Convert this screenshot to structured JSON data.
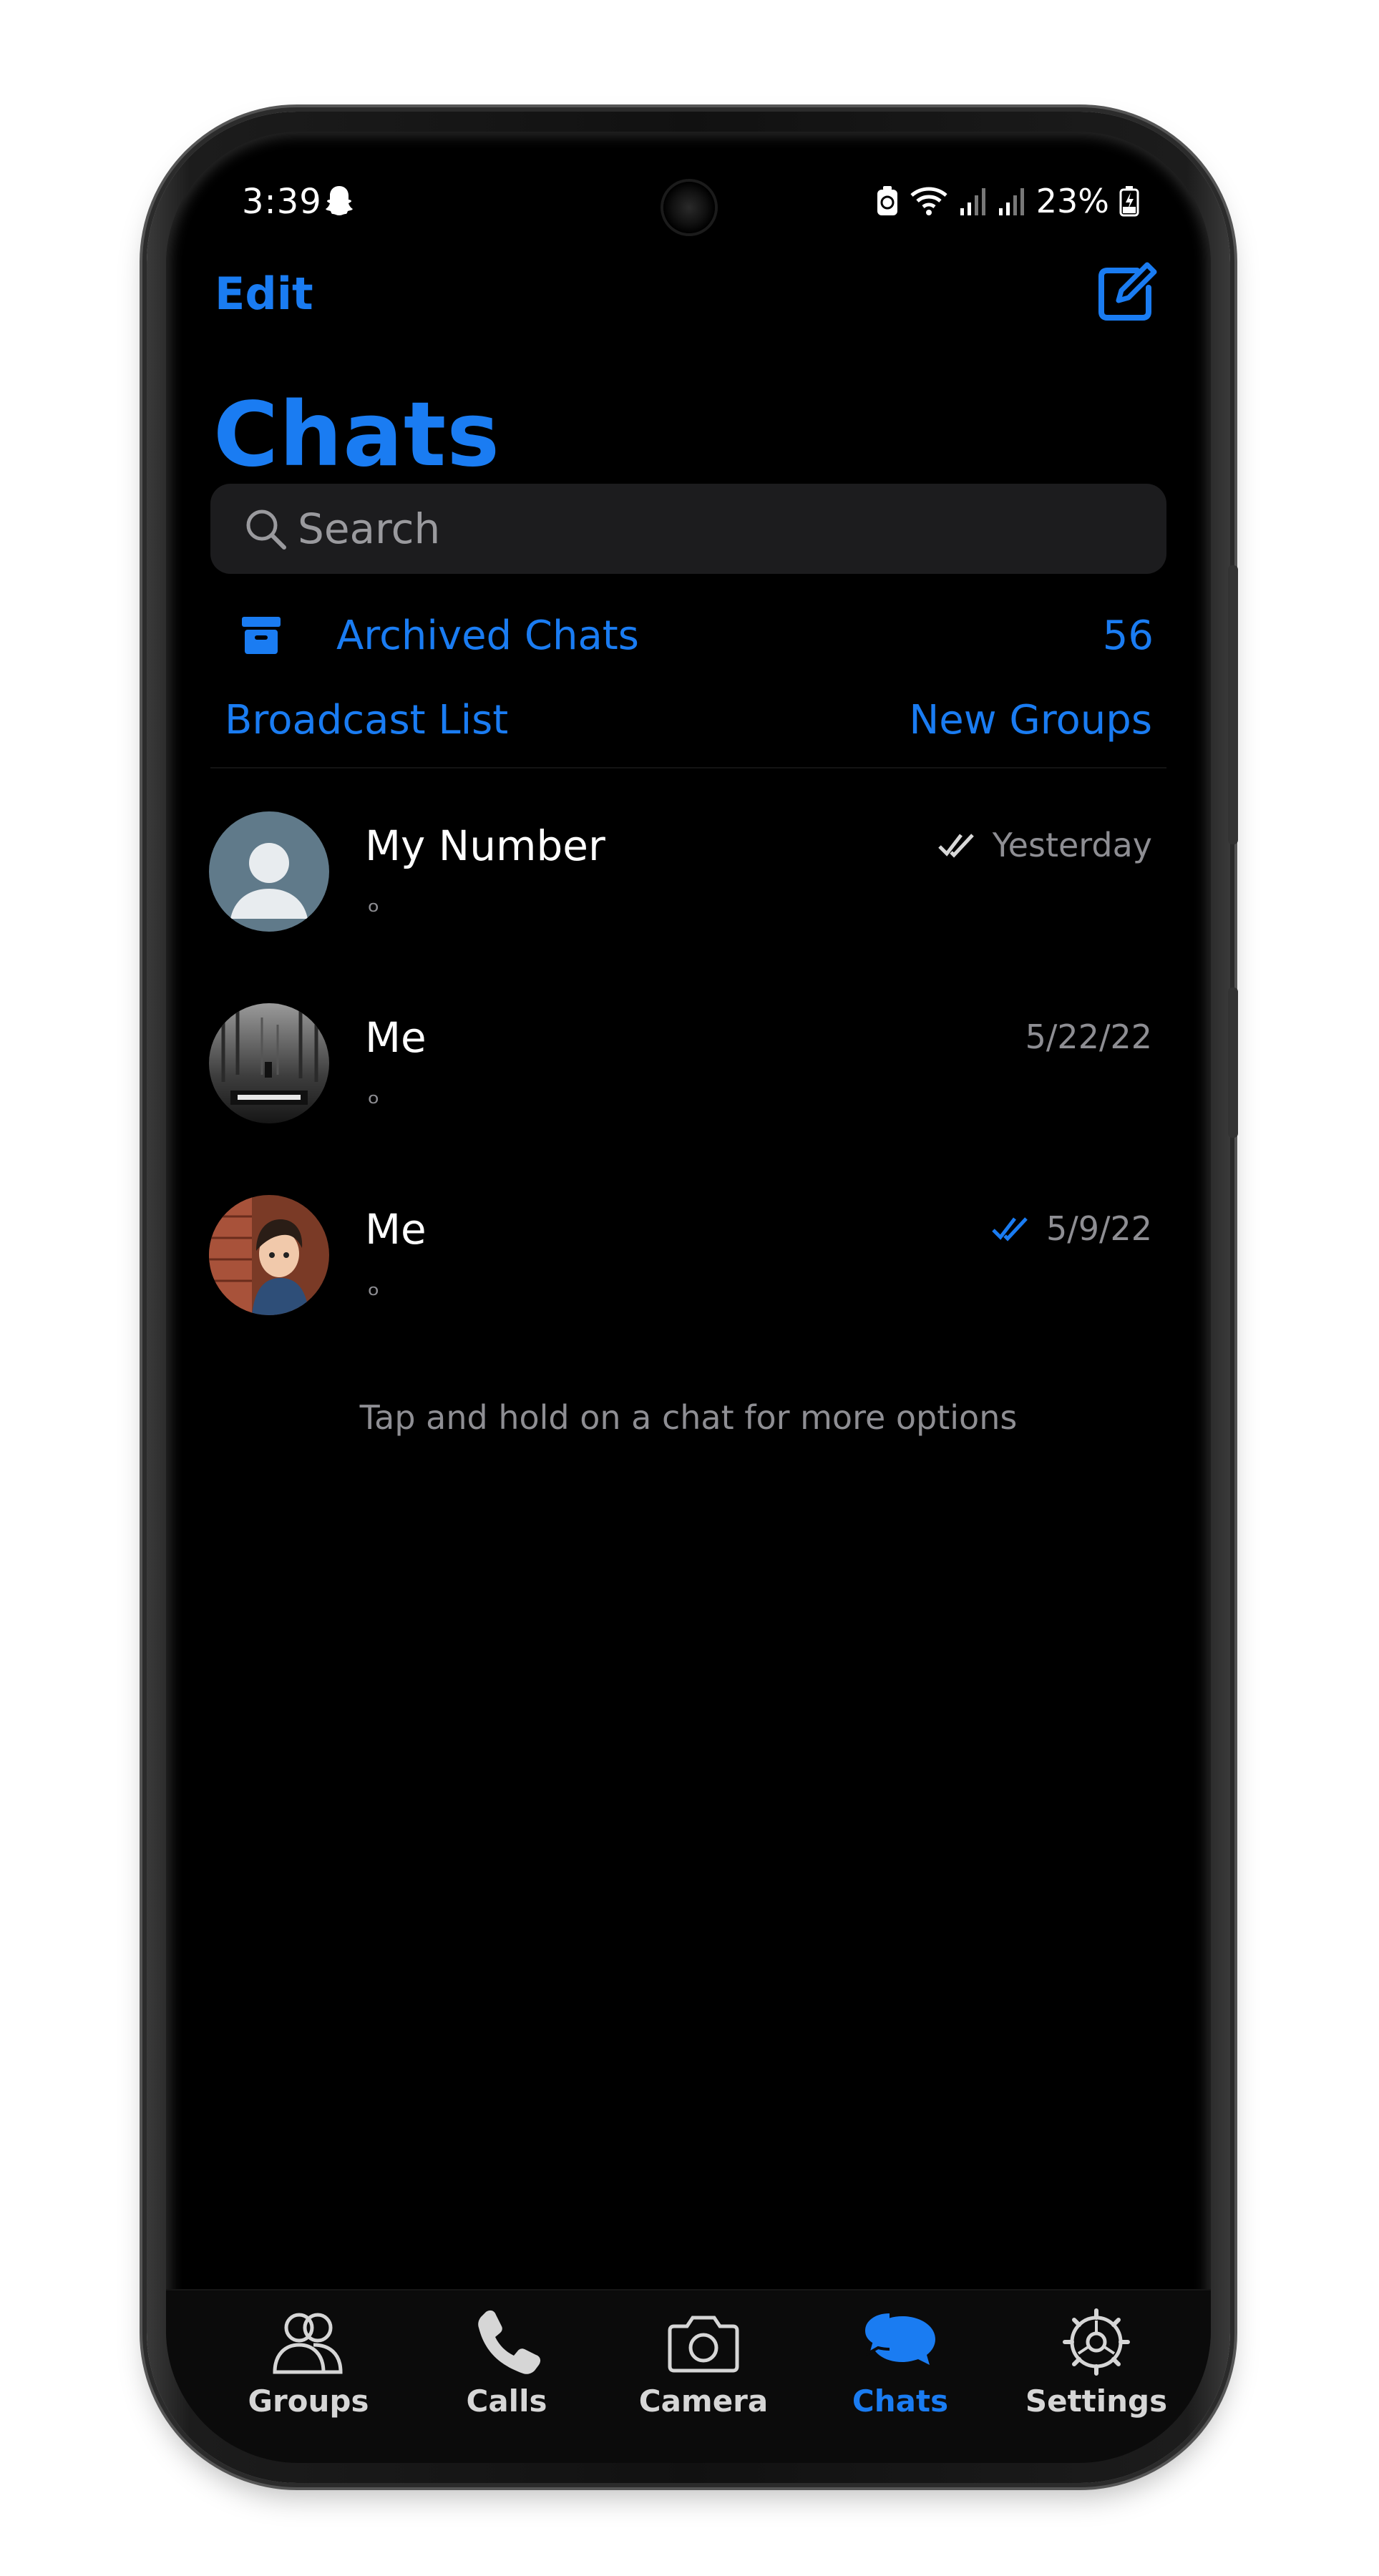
{
  "status_bar": {
    "time": "3:39",
    "battery_percent": "23%",
    "left_icon": "snapchat-ghost-icon",
    "right_icons": [
      "battery-saver-icon",
      "wifi-icon",
      "signal-icon",
      "signal-icon",
      "battery-charging-icon"
    ]
  },
  "header": {
    "edit_label": "Edit",
    "compose_icon": "compose-icon",
    "title": "Chats"
  },
  "search": {
    "placeholder": "Search"
  },
  "archived": {
    "label": "Archived Chats",
    "count": "56"
  },
  "links": {
    "broadcast": "Broadcast List",
    "new_groups": "New Groups"
  },
  "chats": [
    {
      "name": "My Number",
      "preview": "ₒ",
      "time": "Yesterday",
      "receipt": "read-grey",
      "avatar": "default-avatar"
    },
    {
      "name": "Me",
      "preview": "ₒ",
      "time": "5/22/22",
      "receipt": "none",
      "avatar": "dont-wait-photo"
    },
    {
      "name": "Me",
      "preview": "ₒ",
      "time": "5/9/22",
      "receipt": "read-blue",
      "avatar": "cartoon-boy-photo"
    }
  ],
  "hint": "Tap and hold on a chat for more options",
  "tabs": [
    {
      "label": "Groups",
      "icon": "groups-icon",
      "active": false
    },
    {
      "label": "Calls",
      "icon": "phone-icon",
      "active": false
    },
    {
      "label": "Camera",
      "icon": "camera-icon",
      "active": false
    },
    {
      "label": "Chats",
      "icon": "chat-bubbles-icon",
      "active": true
    },
    {
      "label": "Settings",
      "icon": "gear-icon",
      "active": false
    }
  ],
  "colors": {
    "accent": "#1a7cf2",
    "background": "#000000",
    "secondary_text": "#8e8e93",
    "search_bg": "#1c1c1e"
  }
}
